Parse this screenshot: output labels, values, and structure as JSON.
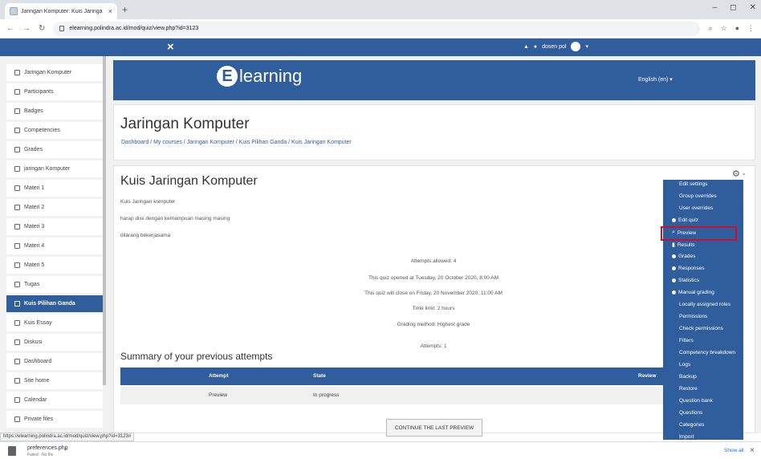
{
  "browser": {
    "tab_title": "Jaringan Komputer: Kuis Jaringa",
    "tab_close": "×",
    "new_tab": "+",
    "url": "elearning.polindra.ac.id/mod/quiz/view.php?id=3123",
    "status_url": "https://elearning.polindra.ac.id/mod/quiz/view.php?id=3123#"
  },
  "navbar": {
    "menu_toggle": "×",
    "user_name": "dosen pol"
  },
  "banner": {
    "logo_text": "learning",
    "logo_mark": "E",
    "language": "English (en) ▾"
  },
  "sidebar": {
    "items": [
      {
        "label": "Jaringan Komputer",
        "icon": "graduation-cap-icon"
      },
      {
        "label": "Participants",
        "icon": "users-icon"
      },
      {
        "label": "Badges",
        "icon": "shield-icon"
      },
      {
        "label": "Competencies",
        "icon": "check-square-icon"
      },
      {
        "label": "Grades",
        "icon": "table-icon"
      },
      {
        "label": "jaringan Komputer",
        "icon": "folder-icon"
      },
      {
        "label": "Materi 1",
        "icon": "folder-icon"
      },
      {
        "label": "Materi 2",
        "icon": "folder-icon"
      },
      {
        "label": "Materi 3",
        "icon": "folder-icon"
      },
      {
        "label": "Materi 4",
        "icon": "folder-icon"
      },
      {
        "label": "Materi 5",
        "icon": "folder-icon"
      },
      {
        "label": "Tugas",
        "icon": "folder-icon"
      },
      {
        "label": "Kuis Pilihan Ganda",
        "icon": "folder-icon",
        "active": true
      },
      {
        "label": "Kuis Essay",
        "icon": "folder-icon"
      },
      {
        "label": "Diskusi",
        "icon": "folder-icon"
      },
      {
        "label": "Dashboard",
        "icon": "dashboard-icon"
      },
      {
        "label": "Site home",
        "icon": "home-icon"
      },
      {
        "label": "Calendar",
        "icon": "calendar-icon"
      },
      {
        "label": "Private files",
        "icon": "file-icon"
      }
    ]
  },
  "header": {
    "title": "Jaringan Komputer",
    "breadcrumb": "Dashboard / My courses / Jaringan Komputer / Kuis Pilihan Ganda / Kuis Jaringan Komputer"
  },
  "quiz": {
    "title": "Kuis Jaringan Komputer",
    "description": [
      "Kuis Jaringan komputer",
      "harap diisi dengan kemampuan masing masing",
      "dilarang bekerjasama"
    ],
    "attempts_allowed": "Attempts allowed: 4",
    "opened": "This quiz opened at Tuesday, 20 October 2020, 8:00 AM",
    "closes": "This quiz will close on Friday, 20 November 2020, 11:00 AM",
    "time_limit": "Time limit: 2 hours",
    "grading": "Grading method: Highest grade",
    "attempts": "Attempts: 1",
    "summary_title": "Summary of your previous attempts",
    "table_headers": [
      "Attempt",
      "State",
      "Review"
    ],
    "row": [
      "Preview",
      "In progress"
    ],
    "continue_label": "CONTINUE THE LAST PREVIEW"
  },
  "admin_menu": {
    "items": [
      {
        "label": "Edit settings",
        "bullet": false
      },
      {
        "label": "Group overrides",
        "bullet": false
      },
      {
        "label": "User overrides",
        "bullet": false
      },
      {
        "label": "Edit quiz",
        "bullet": true
      },
      {
        "label": "Preview",
        "bullet": "search"
      },
      {
        "label": "Results",
        "bullet": "bar"
      },
      {
        "label": "Grades",
        "bullet": true
      },
      {
        "label": "Responses",
        "bullet": true
      },
      {
        "label": "Statistics",
        "bullet": true
      },
      {
        "label": "Manual grading",
        "bullet": true
      },
      {
        "label": "Locally assigned roles",
        "bullet": false
      },
      {
        "label": "Permissions",
        "bullet": false
      },
      {
        "label": "Check permissions",
        "bullet": false
      },
      {
        "label": "Filters",
        "bullet": false
      },
      {
        "label": "Competency breakdown",
        "bullet": false
      },
      {
        "label": "Logs",
        "bullet": false
      },
      {
        "label": "Backup",
        "bullet": false
      },
      {
        "label": "Restore",
        "bullet": false
      },
      {
        "label": "Question bank",
        "bullet": false
      },
      {
        "label": "Questions",
        "bullet": false
      },
      {
        "label": "Categories",
        "bullet": false
      },
      {
        "label": "Import",
        "bullet": false
      }
    ]
  },
  "downloads": {
    "file_name": "preferences.php",
    "file_status": "Failed - No file",
    "show_all": "Show all",
    "close": "×"
  },
  "colors": {
    "primary": "#305e9d",
    "highlight": "#c8102e"
  }
}
